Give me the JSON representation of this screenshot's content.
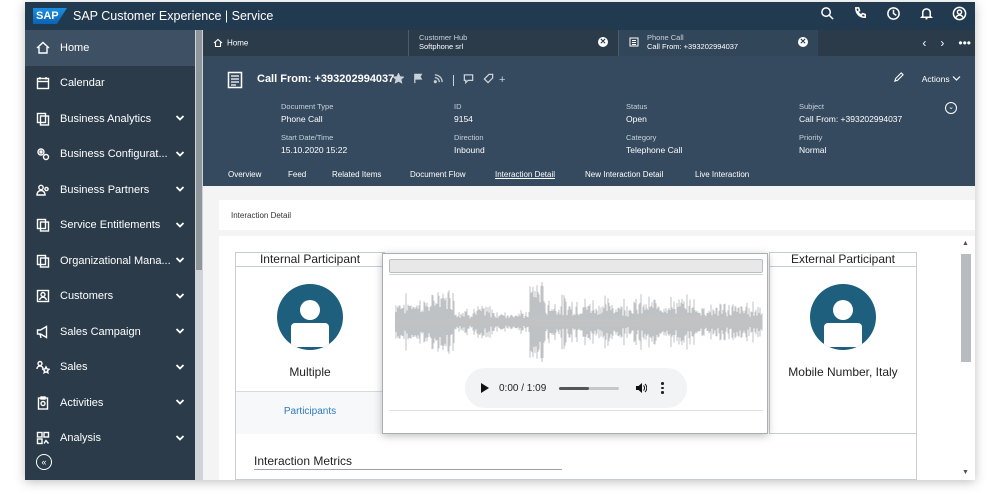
{
  "shell": {
    "logo": "SAP",
    "title": "SAP Customer Experience | Service"
  },
  "sidebar": {
    "items": [
      {
        "label": "Home",
        "icon": "home-icon",
        "expandable": false,
        "active": true
      },
      {
        "label": "Calendar",
        "icon": "calendar-icon",
        "expandable": false
      },
      {
        "label": "Business Analytics",
        "icon": "copy-icon",
        "expandable": true
      },
      {
        "label": "Business Configurat...",
        "icon": "gears-icon",
        "expandable": true
      },
      {
        "label": "Business Partners",
        "icon": "partners-icon",
        "expandable": true
      },
      {
        "label": "Service Entitlements",
        "icon": "copy-icon",
        "expandable": true
      },
      {
        "label": "Organizational Mana...",
        "icon": "copy-icon",
        "expandable": true
      },
      {
        "label": "Customers",
        "icon": "customers-icon",
        "expandable": true
      },
      {
        "label": "Sales Campaign",
        "icon": "megaphone-icon",
        "expandable": true
      },
      {
        "label": "Sales",
        "icon": "sales-icon",
        "expandable": true
      },
      {
        "label": "Activities",
        "icon": "clipboard-icon",
        "expandable": true
      },
      {
        "label": "Analysis",
        "icon": "analysis-icon",
        "expandable": true
      }
    ],
    "collapse_glyph": "«"
  },
  "tabs": {
    "home": "Home",
    "hub": {
      "sub": "Customer Hub",
      "main": "Softphone srl"
    },
    "call": {
      "sub": "Phone Call",
      "main": "Call From: +393202994037"
    },
    "close_glyph": "✕"
  },
  "header": {
    "title": "Call From: +393202994037",
    "actions": "Actions",
    "attributes": [
      {
        "label": "Document Type",
        "value": "Phone Call"
      },
      {
        "label": "ID",
        "value": "9154"
      },
      {
        "label": "Status",
        "value": "Open"
      },
      {
        "label": "Subject",
        "value": "Call From: +393202994037"
      },
      {
        "label": "Start Date/Time",
        "value": "15.10.2020 15:22"
      },
      {
        "label": "Direction",
        "value": "Inbound"
      },
      {
        "label": "Category",
        "value": "Telephone Call"
      },
      {
        "label": "Priority",
        "value": "Normal"
      }
    ]
  },
  "subtabs": [
    "Overview",
    "Feed",
    "Related Items",
    "Document Flow",
    "Interaction Detail",
    "New Interaction Detail",
    "Live Interaction"
  ],
  "active_subtab": "Interaction Detail",
  "section": {
    "title": "Interaction Detail"
  },
  "internal": {
    "title": "Internal Participant",
    "name": "Multiple",
    "link": "Participants"
  },
  "external": {
    "title": "External Participant",
    "name": "Mobile Number, Italy"
  },
  "metrics": {
    "title": "Interaction Metrics"
  },
  "player": {
    "time": "0:00 / 1:09",
    "progress": 0.5
  }
}
